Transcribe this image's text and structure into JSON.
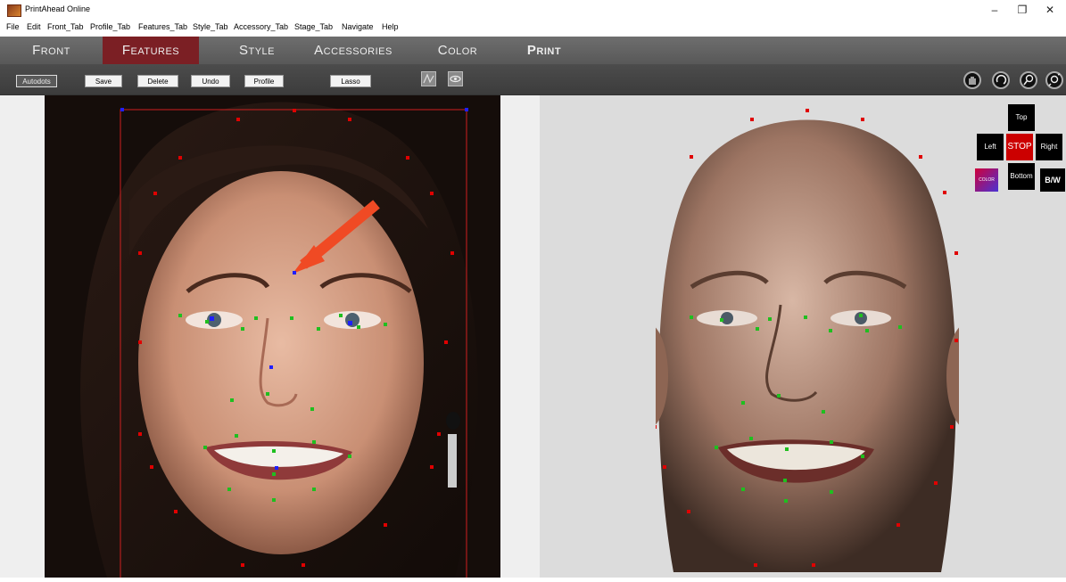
{
  "app": {
    "title": "PrintAhead Online"
  },
  "window_controls": {
    "minimize": "–",
    "maximize": "❐",
    "close": "✕"
  },
  "menu": [
    "File",
    "Edit",
    "Front_Tab",
    "Profile_Tab",
    "Features_Tab",
    "Style_Tab",
    "Accessory_Tab",
    "Stage_Tab",
    "Navigate",
    "Help"
  ],
  "tabs": [
    "Front",
    "Features",
    "Style",
    "Accessories",
    "Color",
    "Print"
  ],
  "active_tab": "Features",
  "toolbar": {
    "autodots": "Autodots",
    "save": "Save",
    "delete": "Delete",
    "undo": "Undo",
    "profile": "Profile",
    "lasso": "Lasso",
    "icons": [
      "curve-icon",
      "eye-icon",
      "hand-icon",
      "rotate-icon",
      "zoom-icon",
      "zoom-fit-icon"
    ]
  },
  "view_controls": {
    "top": "Top",
    "left": "Left",
    "stop": "STOP",
    "right": "Right",
    "bottom": "Bottom",
    "color": "COLOR",
    "bw": "B/W"
  },
  "colors": {
    "accent_tab": "#7b1f24",
    "stop_button": "#cc0000",
    "dot_red": "#e00000",
    "dot_green": "#1fbf1f",
    "dot_blue": "#1f1fff",
    "arrow": "#f04a24"
  }
}
